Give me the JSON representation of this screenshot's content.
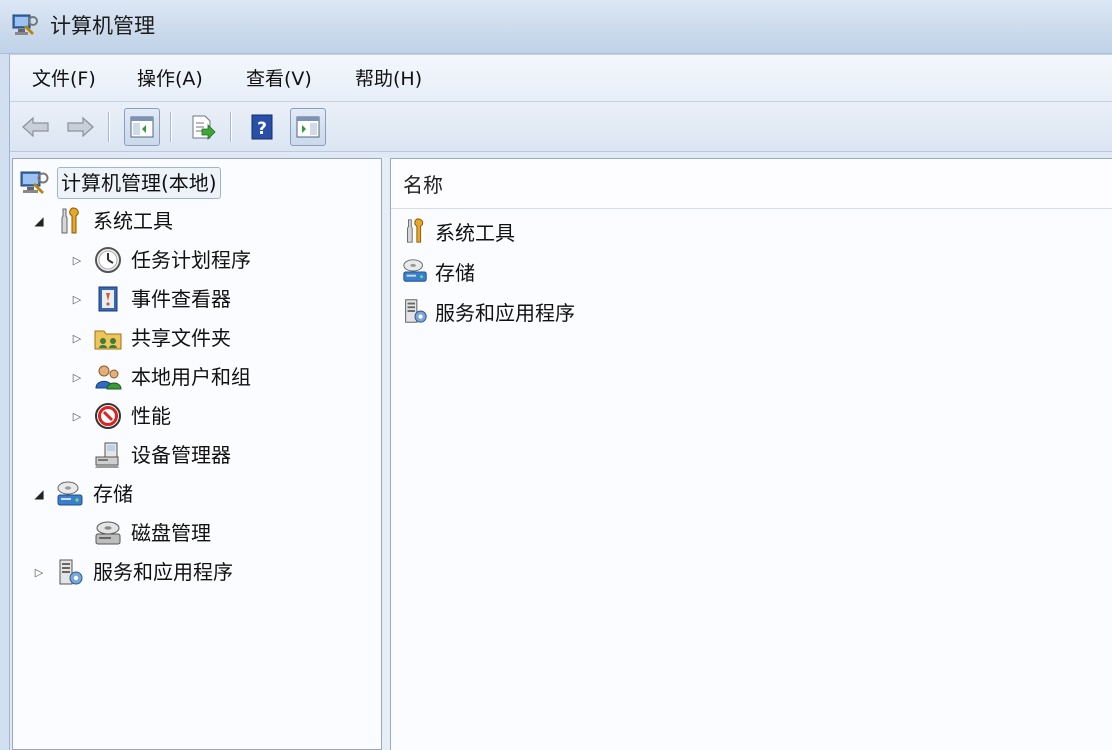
{
  "window": {
    "title": "计算机管理",
    "icon": "computer-management-icon"
  },
  "menubar": {
    "items": [
      {
        "label": "文件(F)"
      },
      {
        "label": "操作(A)"
      },
      {
        "label": "查看(V)"
      },
      {
        "label": "帮助(H)"
      }
    ]
  },
  "toolbar": {
    "buttons": [
      {
        "icon": "back-arrow-icon"
      },
      {
        "icon": "forward-arrow-icon"
      },
      {
        "icon": "show-hide-console-tree-icon",
        "pressed": true
      },
      {
        "icon": "export-list-icon"
      },
      {
        "icon": "help-icon"
      },
      {
        "icon": "show-hide-action-pane-icon",
        "pressed": true
      }
    ]
  },
  "tree": {
    "root": {
      "label": "计算机管理(本地)",
      "icon": "computer-management-icon",
      "selected": true
    },
    "items": [
      {
        "label": "系统工具",
        "icon": "tools-icon",
        "level": 1,
        "state": "expanded"
      },
      {
        "label": "任务计划程序",
        "icon": "clock-icon",
        "level": 2,
        "state": "collapsed"
      },
      {
        "label": "事件查看器",
        "icon": "event-viewer-icon",
        "level": 2,
        "state": "collapsed"
      },
      {
        "label": "共享文件夹",
        "icon": "shared-folder-icon",
        "level": 2,
        "state": "collapsed"
      },
      {
        "label": "本地用户和组",
        "icon": "users-icon",
        "level": 2,
        "state": "collapsed"
      },
      {
        "label": "性能",
        "icon": "performance-icon",
        "level": 2,
        "state": "collapsed"
      },
      {
        "label": "设备管理器",
        "icon": "device-manager-icon",
        "level": 2,
        "state": "none"
      },
      {
        "label": "存储",
        "icon": "storage-icon",
        "level": 1,
        "state": "expanded"
      },
      {
        "label": "磁盘管理",
        "icon": "disk-management-icon",
        "level": 2,
        "state": "none"
      },
      {
        "label": "服务和应用程序",
        "icon": "services-icon",
        "level": 1,
        "state": "collapsed"
      }
    ]
  },
  "list": {
    "column_header": "名称",
    "items": [
      {
        "label": "系统工具",
        "icon": "tools-icon"
      },
      {
        "label": "存储",
        "icon": "storage-icon"
      },
      {
        "label": "服务和应用程序",
        "icon": "services-icon"
      }
    ]
  },
  "colors": {
    "titlebar": "#cfdded",
    "menubar": "#eef3fa",
    "pane_background": "#fbfcff",
    "border": "#99a9bf"
  }
}
